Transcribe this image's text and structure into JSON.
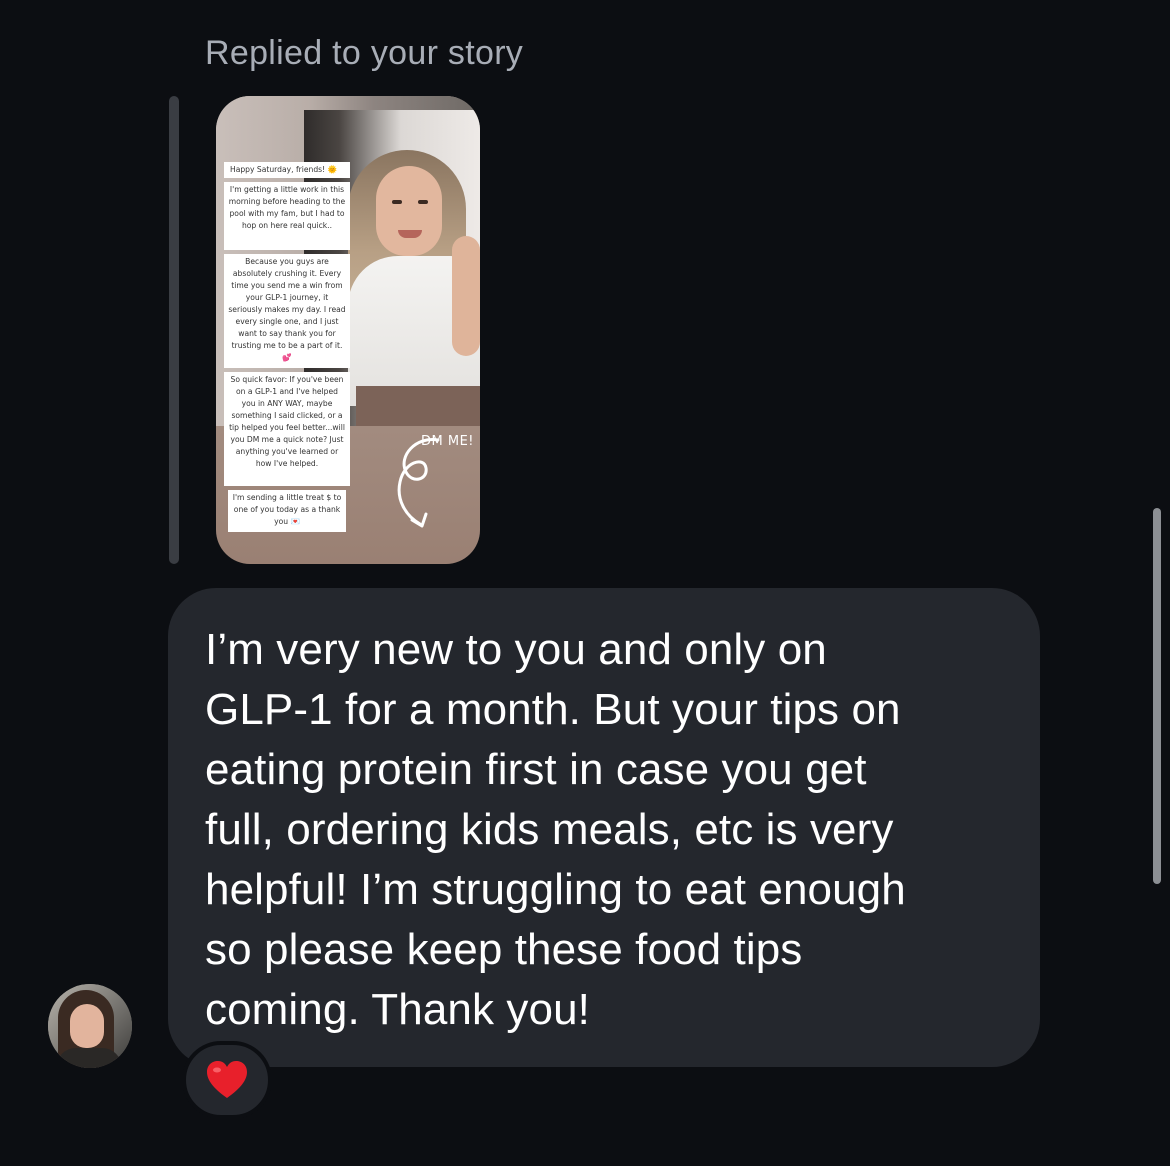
{
  "reply": {
    "header": "Replied to your story"
  },
  "story": {
    "notes": [
      "Happy Saturday, friends! 🌞",
      "I'm getting a little work in this morning before heading to the pool with my fam, but I had to hop on here real quick..",
      "Because you guys are absolutely crushing it. Every time you send me a win from your GLP-1 journey, it seriously makes my day. I read every single one, and I just want to say thank you for trusting me to be a part of it. 💕",
      "So quick favor: If you've been on a GLP-1 and I've helped you in ANY WAY, maybe something I said clicked, or a tip helped you feel better...will you DM me a quick note? Just anything you've learned or how I've helped.",
      "I'm sending a little treat $ to one of you today as a thank you 💌"
    ],
    "dm_label": "DM ME!"
  },
  "message": {
    "text": "I’m very new to you and only on\nGLP-1 for a month. But your tips on\neating protein first in case you get\nfull, ordering kids meals, etc is very\nhelpful! I’m struggling to eat enough\nso please keep these food tips\ncoming. Thank you!"
  },
  "reaction": {
    "emoji": "❤️"
  },
  "colors": {
    "background": "#0c0e12",
    "bubble": "#24272d",
    "header_text": "#a8adb6",
    "reaction_heart": "#e8202b"
  }
}
